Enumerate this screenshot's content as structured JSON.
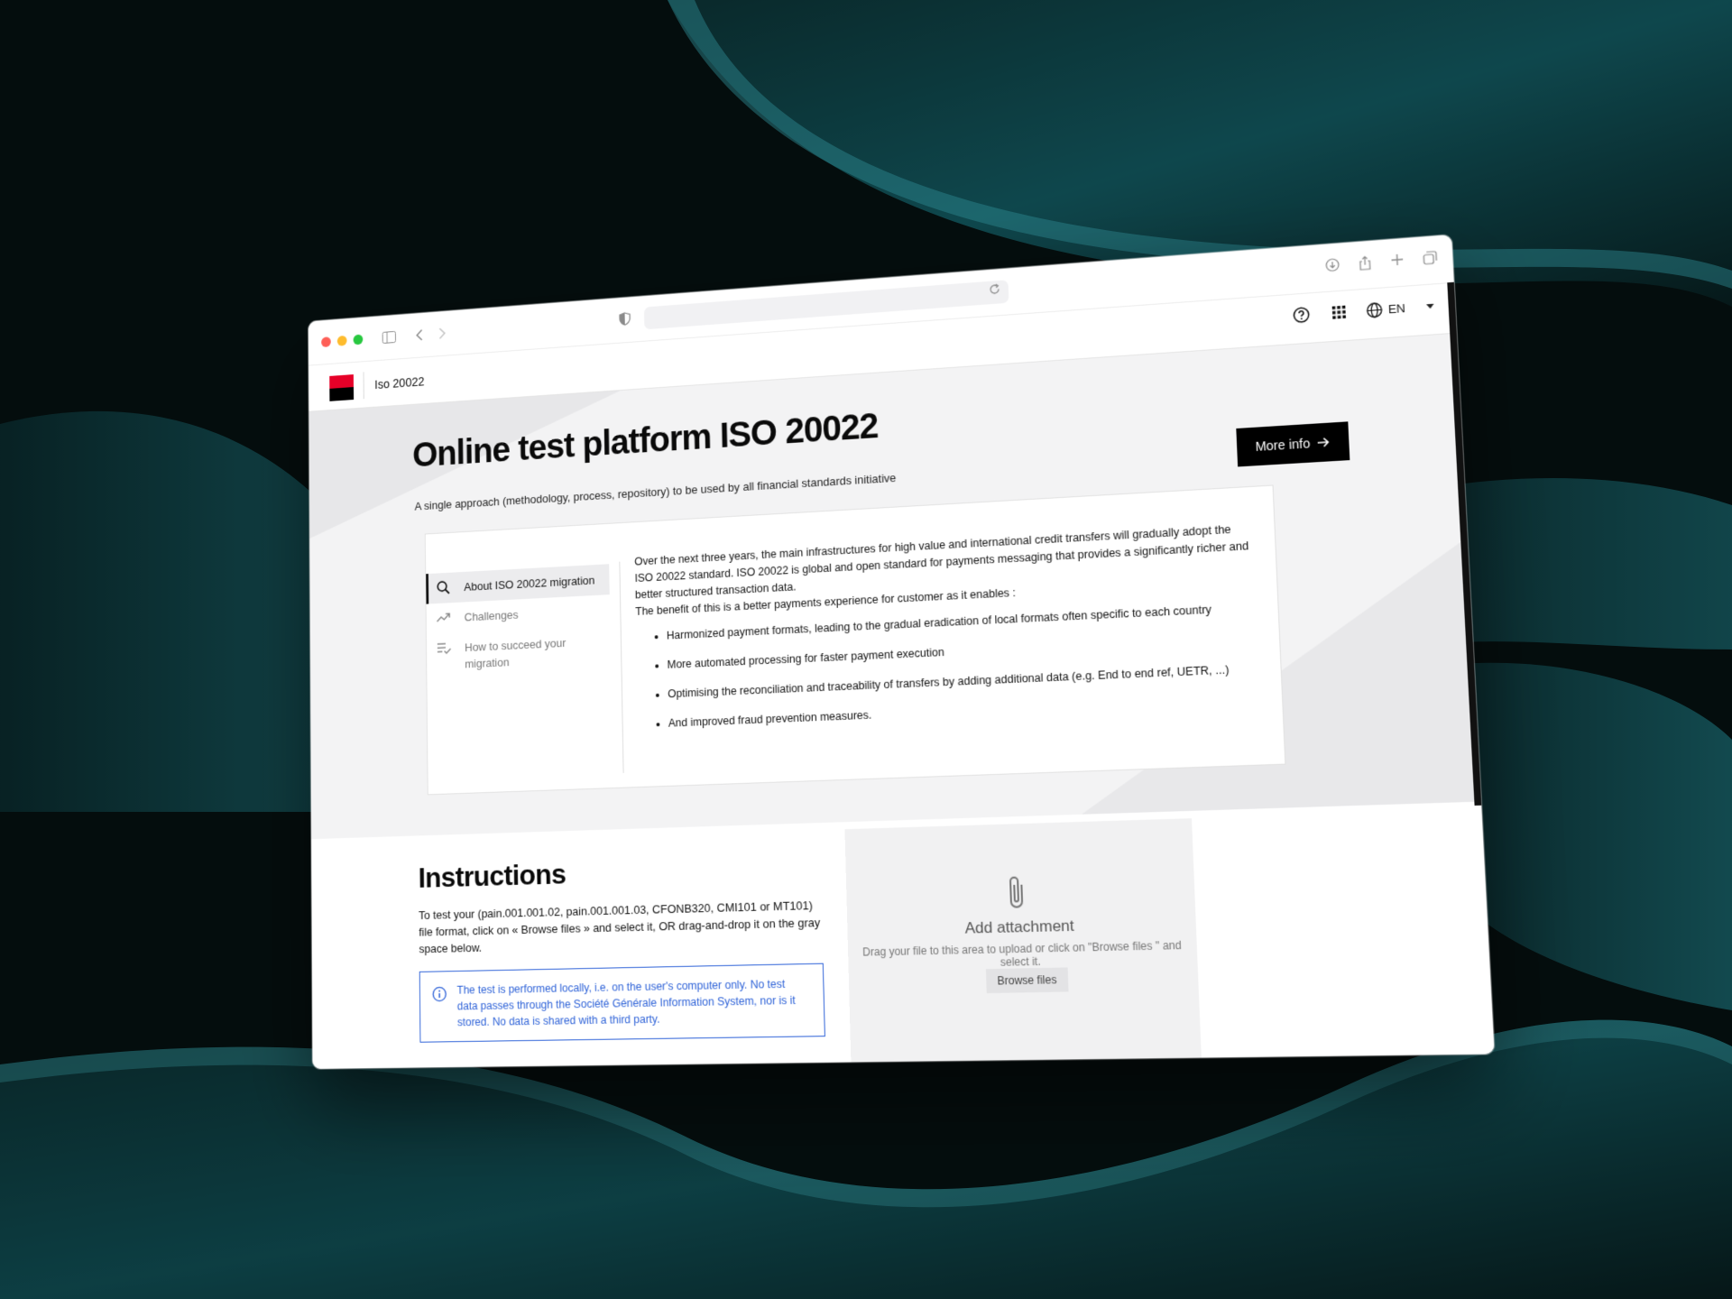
{
  "app": {
    "title": "Iso 20022",
    "language": "EN",
    "brand_colors": {
      "red": "#e60028",
      "black": "#000000"
    }
  },
  "hero": {
    "title": "Online test platform ISO 20022",
    "subtitle": "A single approach (methodology, process, repository) to be used by all financial standards initiative",
    "more_info_label": "More info"
  },
  "sidebar": {
    "items": [
      {
        "label": "About ISO 20022 migration",
        "icon": "search-icon",
        "active": true
      },
      {
        "label": "Challenges",
        "icon": "trending-up-icon",
        "active": false
      },
      {
        "label": "How to succeed your migration",
        "icon": "checklist-icon",
        "active": false
      }
    ]
  },
  "content": {
    "intro": "Over the next three years, the main infrastructures for high value and international credit transfers will gradually adopt the ISO 20022 standard. ISO 20022 is global and open standard for payments messaging that provides a significantly richer and better structured transaction data.",
    "benefit": "The benefit of this is a better payments experience for customer as it enables :",
    "bullets": [
      "Harmonized payment formats, leading to the gradual eradication of local formats often specific to each country",
      "More automated processing for faster payment execution",
      "Optimising the reconciliation and traceability of transfers by adding additional data (e.g. End to end ref, UETR, ...)",
      "And improved fraud prevention measures."
    ]
  },
  "instructions": {
    "title": "Instructions",
    "description": "To test your (pain.001.001.02, pain.001.001.03, CFONB320, CMI101 or MT101) file format, click on « Browse files » and select it, OR drag-and-drop it on the gray space below.",
    "notice": "The test is performed locally, i.e. on the user's computer only. No test data passes through the Société Générale Information System, nor is it stored. No data is shared with a third party.",
    "notice_color": "#2f63d8"
  },
  "upload": {
    "title": "Add attachment",
    "hint": "Drag your file to this area to upload or click on \"Browse files \" and select it.",
    "browse_label": "Browse files"
  }
}
